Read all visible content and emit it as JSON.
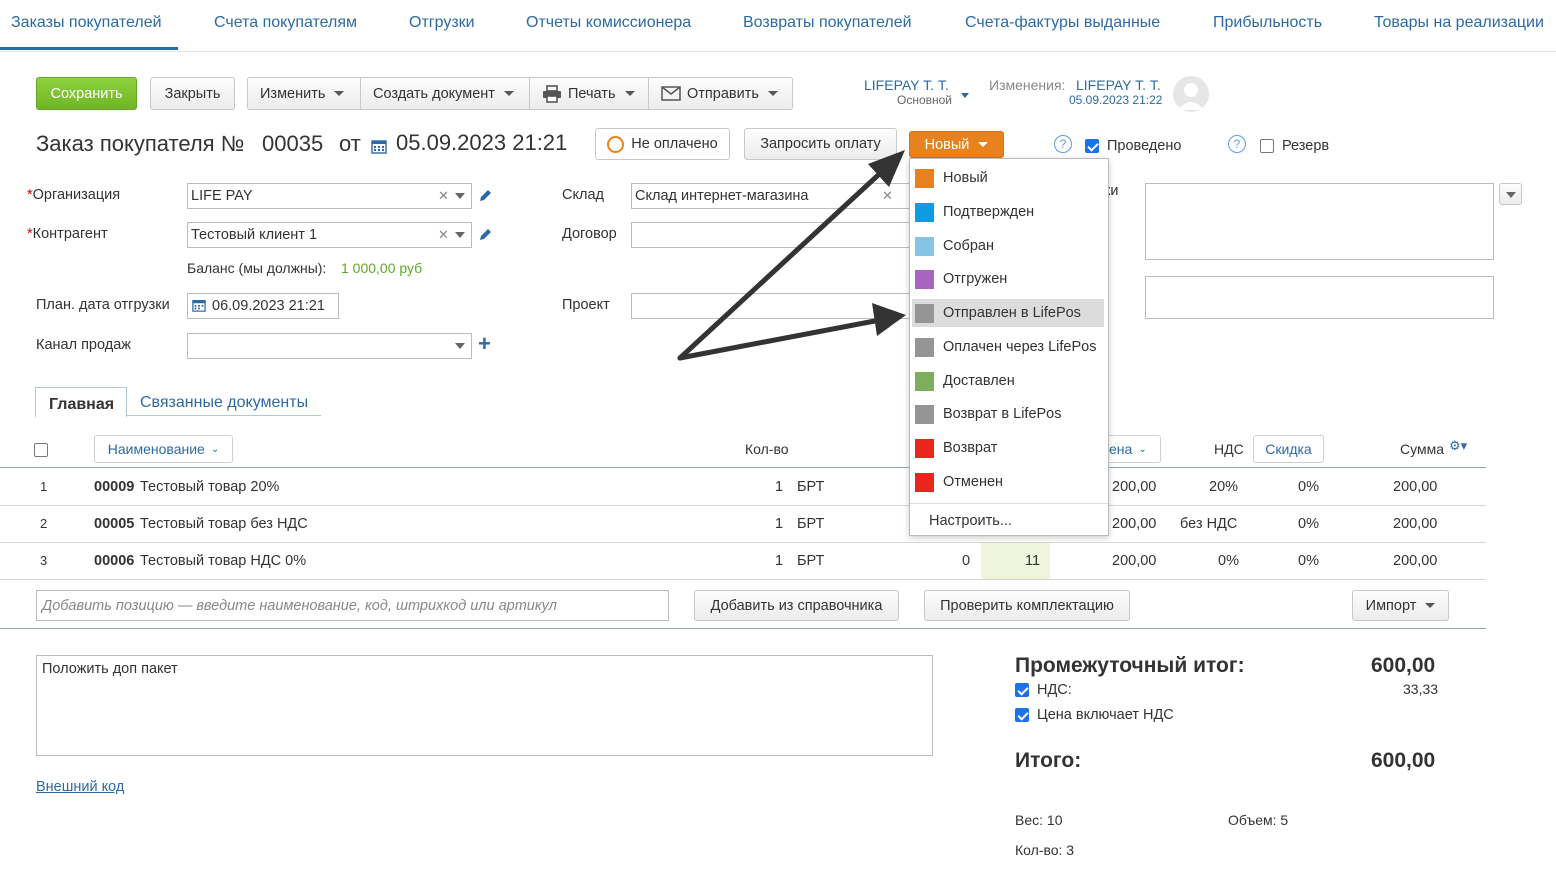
{
  "nav": {
    "tabs": [
      "Заказы покупателей",
      "Счета покупателям",
      "Отгрузки",
      "Отчеты комиссионера",
      "Возвраты покупателей",
      "Счета-фактуры выданные",
      "Прибыльность",
      "Товары на реализации"
    ],
    "active_index": 0
  },
  "toolbar": {
    "save": "Сохранить",
    "close": "Закрыть",
    "edit": "Изменить",
    "create_doc": "Создать документ",
    "print": "Печать",
    "send": "Отправить"
  },
  "owner": {
    "name": "LIFEPAY Т. Т.",
    "group": "Основной"
  },
  "changes": {
    "label": "Изменения:",
    "name": "LIFEPAY Т. Т.",
    "date": "05.09.2023 21:22"
  },
  "doc": {
    "title": "Заказ покупателя №",
    "number": "00035",
    "from": "от",
    "datetime": "05.09.2023 21:21",
    "payment_status": "Не оплачено",
    "request_payment": "Запросить оплату",
    "status": "Новый",
    "posted_label": "Проведено",
    "posted": true,
    "reserve_label": "Резерв",
    "reserve": false,
    "help": "?"
  },
  "form": {
    "org_label": "Организация",
    "org_value": "LIFE PAY",
    "counterparty_label": "Контрагент",
    "counterparty_value": "Тестовый клиент 1",
    "balance_label": "Баланс (мы должны):",
    "balance_value": "1 000,00 руб",
    "ship_date_label": "План. дата отгрузки",
    "ship_date_value": "06.09.2023 21:21",
    "channel_label": "Канал продаж",
    "channel_value": "",
    "warehouse_label": "Склад",
    "warehouse_value": "Склад интернет-магазина",
    "contract_label": "Договор",
    "contract_value": "",
    "project_label": "Проект",
    "project_value": "",
    "partial_label": "ки"
  },
  "tabs": {
    "main": "Главная",
    "related": "Связанные документы"
  },
  "table": {
    "headers": {
      "name": "Наименование",
      "qty": "Кол-во",
      "price": "ена",
      "vat": "НДС",
      "discount": "Скидка",
      "sum": "Сумма"
    },
    "rows": [
      {
        "n": "1",
        "code": "00009",
        "name": "Тестовый товар 20%",
        "qty": "1",
        "unit": "БРТ",
        "price": "200,00",
        "vat": "20%",
        "discount": "0%",
        "sum": "200,00"
      },
      {
        "n": "2",
        "code": "00005",
        "name": "Тестовый товар без НДС",
        "qty": "1",
        "unit": "БРТ",
        "price": "200,00",
        "vat": "без НДС",
        "discount": "0%",
        "sum": "200,00"
      },
      {
        "n": "3",
        "code": "00006",
        "name": "Тестовый товар НДС 0%",
        "qty": "1",
        "unit": "БРТ",
        "extra1": "0",
        "extra2": "11",
        "price": "200,00",
        "vat": "0%",
        "discount": "0%",
        "sum": "200,00"
      }
    ],
    "add_placeholder": "Добавить позицию — введите наименование, код, штрихкод или артикул",
    "add_from_catalog": "Добавить из справочника",
    "check_kit": "Проверить комплектацию",
    "import": "Импорт"
  },
  "comment": "Положить доп пакет",
  "external_code": "Внешний код",
  "totals": {
    "subtotal_label": "Промежуточный итог:",
    "subtotal": "600,00",
    "vat_label": "НДС:",
    "vat": "33,33",
    "price_incl_vat_label": "Цена включает НДС",
    "total_label": "Итого:",
    "total": "600,00",
    "weight": "Вес: 10",
    "volume": "Объем: 5",
    "qty": "Кол-во: 3"
  },
  "status_menu": {
    "items": [
      {
        "label": "Новый",
        "color": "#e8821e"
      },
      {
        "label": "Подтвержден",
        "color": "#0f9be3"
      },
      {
        "label": "Собран",
        "color": "#86c4e3"
      },
      {
        "label": "Отгружен",
        "color": "#a665c0"
      },
      {
        "label": "Отправлен в LifePos",
        "color": "#959595"
      },
      {
        "label": "Оплачен через LifePos",
        "color": "#959595"
      },
      {
        "label": "Доставлен",
        "color": "#7eae5c"
      },
      {
        "label": "Возврат в LifePos",
        "color": "#959595"
      },
      {
        "label": "Возврат",
        "color": "#e8261e"
      },
      {
        "label": "Отменен",
        "color": "#e8261e"
      }
    ],
    "highlighted_index": 4,
    "configure": "Настроить..."
  }
}
